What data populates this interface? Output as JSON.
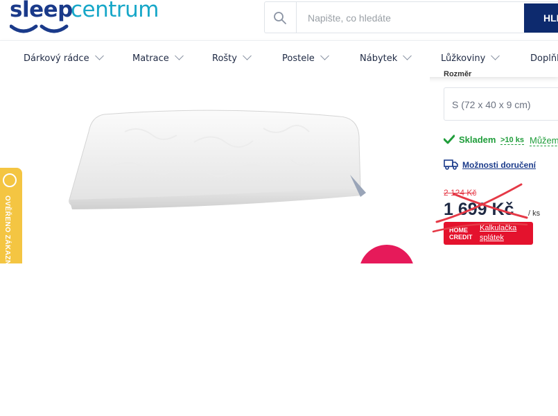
{
  "brand": {
    "part1": "sleep",
    "part2": "centrum"
  },
  "search": {
    "placeholder": "Napište, co hledáte",
    "button_label": "HLEDAT"
  },
  "nav": {
    "items": [
      {
        "label": "Dárkový rádce"
      },
      {
        "label": "Matrace"
      },
      {
        "label": "Rošty"
      },
      {
        "label": "Postele"
      },
      {
        "label": "Nábytek"
      },
      {
        "label": "Lůžkoviny"
      },
      {
        "label": "Doplňky"
      }
    ]
  },
  "verified_badge": {
    "text": "OVĚŘENO ZÁKAZNÍKY"
  },
  "product": {
    "size_label": "Rozměr",
    "size_value": "S (72 x 40 x 9 cm)",
    "stock_label": "Skladem",
    "stock_count": ">10 ks",
    "stock_extra": "Můžeme",
    "delivery_label": "Možnosti doručení",
    "old_price": "2 124 Kč",
    "price": "1 699 Kč",
    "per_unit": "/ ks",
    "homecredit_logo_line1": "HOME",
    "homecredit_logo_line2": "CREDIT",
    "homecredit_link_line1": "Kalkulačka",
    "homecredit_link_line2": "splátek"
  },
  "colors": {
    "brand_dark": "#1a3a8a",
    "brand_light": "#17a7c8",
    "stock_green": "#1f9d3a",
    "price_red": "#e53946",
    "homecredit_red": "#e4122d",
    "badge_yellow": "#f4c542",
    "accent_pink": "#e61a5a"
  }
}
